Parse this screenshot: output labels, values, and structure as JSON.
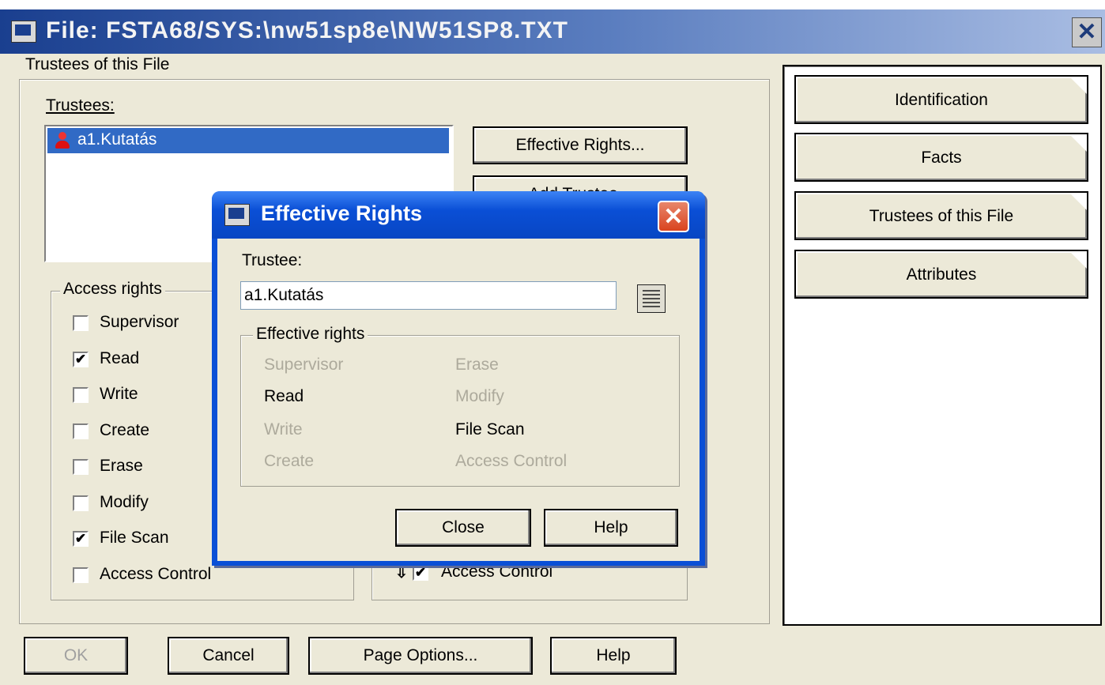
{
  "window": {
    "title": "File: FSTA68/SYS:\\nw51sp8e\\NW51SP8.TXT"
  },
  "section_title": "Trustees of this File",
  "trustees": {
    "label": "Trustees:",
    "items": [
      "a1.Kutatás"
    ],
    "effective_rights_button": "Effective Rights...",
    "add_trustee_button": "Add Trustee..."
  },
  "access_rights": {
    "legend": "Access rights",
    "items": [
      {
        "label": "Supervisor",
        "checked": false
      },
      {
        "label": "Read",
        "checked": true
      },
      {
        "label": "Write",
        "checked": false
      },
      {
        "label": "Create",
        "checked": false
      },
      {
        "label": "Erase",
        "checked": false
      },
      {
        "label": "Modify",
        "checked": false
      },
      {
        "label": "File Scan",
        "checked": true
      },
      {
        "label": "Access Control",
        "checked": false
      }
    ]
  },
  "inherited_rights": {
    "visible_item": {
      "label": "Access Control",
      "checked": true
    }
  },
  "tabs": [
    "Identification",
    "Facts",
    "Trustees of this File",
    "Attributes"
  ],
  "buttons": {
    "ok": "OK",
    "cancel": "Cancel",
    "page_options": "Page Options...",
    "help": "Help"
  },
  "dialog": {
    "title": "Effective Rights",
    "trustee_label": "Trustee:",
    "trustee_value": "a1.Kutatás",
    "rights_legend": "Effective rights",
    "rights": [
      {
        "label": "Supervisor",
        "granted": false
      },
      {
        "label": "Erase",
        "granted": false
      },
      {
        "label": "Read",
        "granted": true
      },
      {
        "label": "Modify",
        "granted": false
      },
      {
        "label": "Write",
        "granted": false
      },
      {
        "label": "File Scan",
        "granted": true
      },
      {
        "label": "Create",
        "granted": false
      },
      {
        "label": "Access Control",
        "granted": false
      }
    ],
    "close_button": "Close",
    "help_button": "Help"
  },
  "colors": {
    "titlebar": "#1a3f8f",
    "dialog_frame": "#0a4fd6",
    "selection": "#316ac5",
    "face": "#ece9d8",
    "disabled_text": "#adaa9c"
  }
}
